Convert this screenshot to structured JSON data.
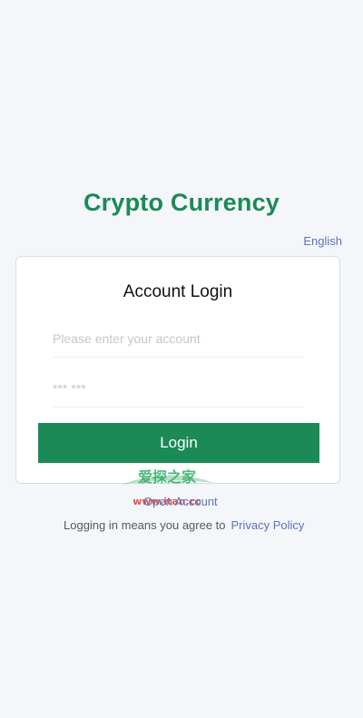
{
  "app": {
    "title": "Crypto Currency"
  },
  "language": {
    "current": "English"
  },
  "login": {
    "title": "Account Login",
    "account_placeholder": "Please enter your account",
    "password_placeholder": "*** ***",
    "button_label": "Login"
  },
  "links": {
    "open_account": "Open Account",
    "agree_text": "Logging in means you agree to",
    "privacy_policy": "Privacy Policy"
  },
  "watermark": {
    "text": "爱探之家",
    "url": "www.itan.cc"
  },
  "colors": {
    "brand": "#1b8a56",
    "link": "#5a73b8",
    "background": "#f4f6fa"
  }
}
